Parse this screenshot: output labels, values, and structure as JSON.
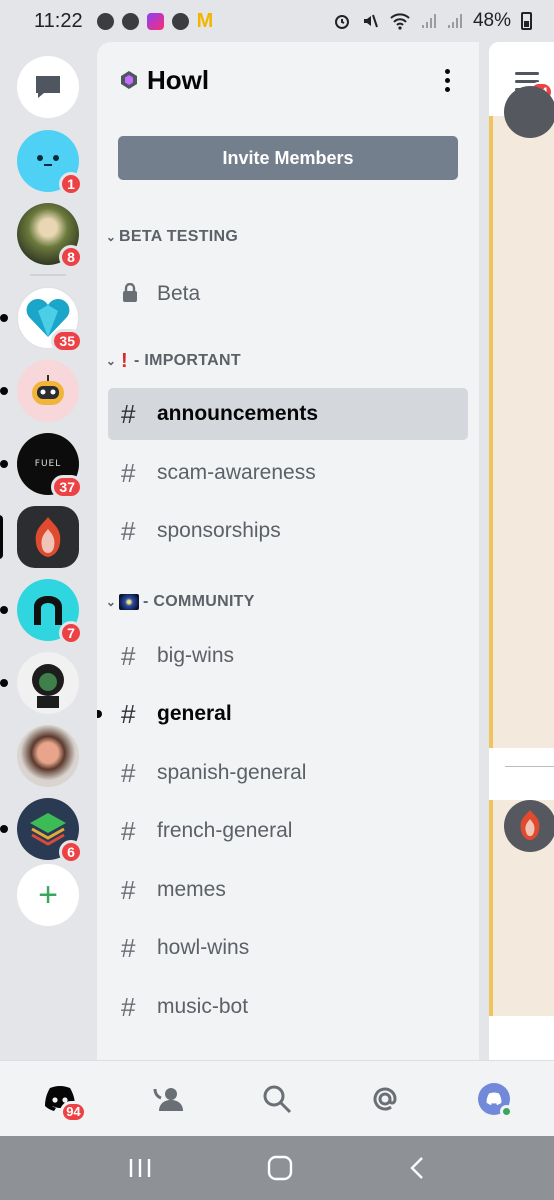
{
  "status_bar": {
    "time": "11:22",
    "battery": "48%",
    "left_icons": [
      "facebook-icon",
      "google-icon",
      "music-app-icon",
      "messenger-icon",
      "mcdonalds-icon"
    ],
    "right_icons": [
      "alarm-icon",
      "mute-icon",
      "wifi-icon",
      "signal-icon",
      "signal-icon",
      "battery-icon"
    ],
    "mcdonalds_glyph": "M"
  },
  "server_rail": {
    "dm_icon": "chat-bubble-icon",
    "servers": [
      {
        "badge": "1",
        "color": "#4fd1f5"
      },
      {
        "badge": "8",
        "color": "#6b7a3c"
      },
      {
        "badge": "35",
        "color": "#ffffff",
        "pill": true
      },
      {
        "badge": "",
        "color": "#f7d7d9",
        "pill": true
      },
      {
        "badge": "37",
        "color": "#0c0c0c",
        "label": "FUEL",
        "pill": true
      },
      {
        "badge": "",
        "color": "#2b2d31",
        "selected": true
      },
      {
        "badge": "7",
        "color": "#2fd6e0",
        "pill": true
      },
      {
        "badge": "",
        "color": "#f1f1f1",
        "pill": true
      },
      {
        "badge": "",
        "color": "#d9d4cf"
      },
      {
        "badge": "6",
        "color": "#2a3a52",
        "pill": true
      }
    ],
    "add_label": "+"
  },
  "guild": {
    "name": "Howl",
    "invite_label": "Invite Members"
  },
  "categories": [
    {
      "label": "BETA TESTING",
      "prefix": ""
    },
    {
      "label": "- IMPORTANT",
      "prefix": "!"
    },
    {
      "label": "- COMMUNITY",
      "prefix": ""
    }
  ],
  "channels": {
    "beta": "Beta",
    "announcements": "announcements",
    "scam_awareness": "scam-awareness",
    "sponsorships": "sponsorships",
    "big_wins": "big-wins",
    "general": "general",
    "spanish_general": "spanish-general",
    "french_general": "french-general",
    "memes": "memes",
    "howl_wins": "howl-wins",
    "music_bot": "music-bot"
  },
  "hash": "#",
  "peek": {
    "badge": "94"
  },
  "bottom_nav": {
    "home_badge": "94",
    "items": [
      "discord-home-icon",
      "friends-icon",
      "search-icon",
      "mentions-icon",
      "profile-avatar-icon"
    ]
  },
  "system_nav": [
    "recents-icon",
    "home-icon",
    "back-icon"
  ]
}
